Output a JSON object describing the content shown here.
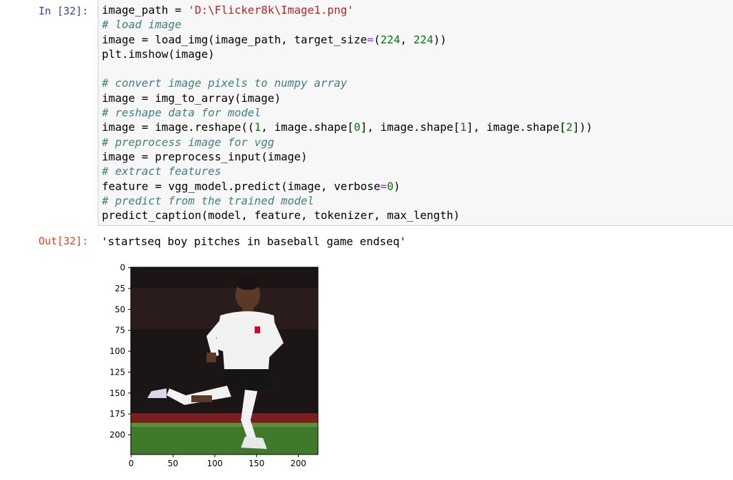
{
  "cell": {
    "in_prompt": "In [32]:",
    "out_prompt": "Out[32]:",
    "code_lines": [
      [
        {
          "t": "image_path = ",
          "c": ""
        },
        {
          "t": "'D:\\Flicker8k\\Image1.png'",
          "c": "cm-string"
        }
      ],
      [
        {
          "t": "# load image",
          "c": "cm-comment"
        }
      ],
      [
        {
          "t": "image = load_img(image_path, target_size",
          "c": ""
        },
        {
          "t": "=",
          "c": "cm-operator"
        },
        {
          "t": "(",
          "c": ""
        },
        {
          "t": "224",
          "c": "cm-number"
        },
        {
          "t": ", ",
          "c": ""
        },
        {
          "t": "224",
          "c": "cm-number"
        },
        {
          "t": "))",
          "c": ""
        }
      ],
      [
        {
          "t": "plt.imshow(image)",
          "c": ""
        }
      ],
      [],
      [
        {
          "t": "# convert image pixels to numpy array",
          "c": "cm-comment"
        }
      ],
      [
        {
          "t": "image = img_to_array(image)",
          "c": ""
        }
      ],
      [
        {
          "t": "# reshape data for model",
          "c": "cm-comment"
        }
      ],
      [
        {
          "t": "image = image.reshape((",
          "c": ""
        },
        {
          "t": "1",
          "c": "cm-number"
        },
        {
          "t": ", image.shape[",
          "c": ""
        },
        {
          "t": "0",
          "c": "cm-number"
        },
        {
          "t": "], image.shape[",
          "c": ""
        },
        {
          "t": "1",
          "c": "cm-number"
        },
        {
          "t": "], image.shape[",
          "c": ""
        },
        {
          "t": "2",
          "c": "cm-number"
        },
        {
          "t": "]))",
          "c": ""
        }
      ],
      [
        {
          "t": "# preprocess image for vgg",
          "c": "cm-comment"
        }
      ],
      [
        {
          "t": "image = preprocess_input(image)",
          "c": ""
        }
      ],
      [
        {
          "t": "# extract features",
          "c": "cm-comment"
        }
      ],
      [
        {
          "t": "feature = vgg_model.predict(image, verbose",
          "c": ""
        },
        {
          "t": "=",
          "c": "cm-operator"
        },
        {
          "t": "0",
          "c": "cm-number"
        },
        {
          "t": ")",
          "c": ""
        }
      ],
      [
        {
          "t": "# predict from the trained model",
          "c": "cm-comment"
        }
      ],
      [
        {
          "t": "predict_caption(model, feature, tokenizer, max_length)",
          "c": ""
        }
      ]
    ],
    "output_text": "'startseq boy pitches in baseball game endseq'"
  },
  "figure": {
    "image_alt": "football player running on pitch",
    "x_ticks": [
      "0",
      "50",
      "100",
      "150",
      "200"
    ],
    "y_ticks": [
      "0",
      "25",
      "50",
      "75",
      "100",
      "125",
      "150",
      "175",
      "200"
    ],
    "x_range": [
      0,
      224
    ],
    "y_range": [
      0,
      224
    ],
    "colors": {
      "background": "#1b1515",
      "crowd_red": "#7a1f1f",
      "pitch": "#3f7a2c",
      "shirt": "#f2f2f2",
      "skin": "#5a3a26"
    }
  }
}
